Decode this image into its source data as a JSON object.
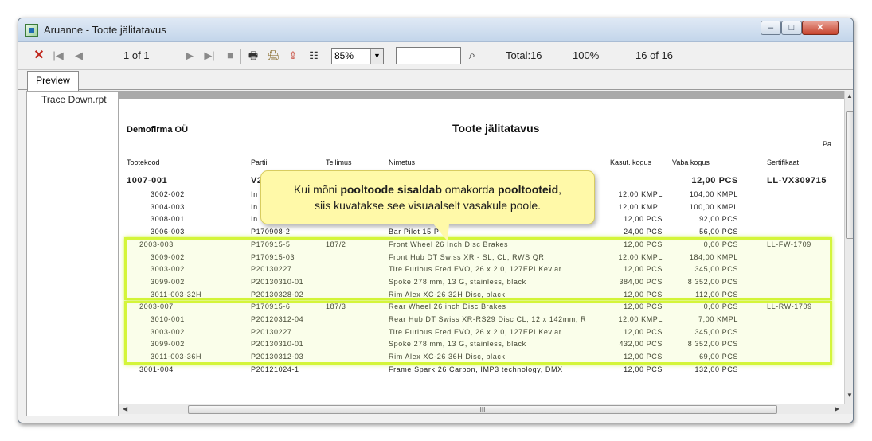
{
  "window": {
    "title": "Aruanne - Toote jälitatavus",
    "controls": {
      "minimize": "–",
      "maximize": "□",
      "close": "✕"
    }
  },
  "toolbar": {
    "page_indicator": "1 of 1",
    "zoom": "85%",
    "search_value": "",
    "total": "Total:16",
    "percent": "100%",
    "record_count": "16 of 16"
  },
  "tabs": {
    "preview": "Preview"
  },
  "tree": {
    "item": "Trace Down.rpt"
  },
  "report": {
    "company": "Demofirma OÜ",
    "title": "Toote jälitatavus",
    "page_label": "Pa",
    "columns": [
      "Tootekood",
      "Partii",
      "Tellimus",
      "Nimetus",
      "Kasut. kogus",
      "Vaba kogus",
      "Sertifikaat"
    ],
    "rows": [
      {
        "code": "1007-001",
        "lot": "V2",
        "order": "",
        "name": "",
        "used": "",
        "free": "12,00 PCS",
        "cert": "LL-VX309715"
      },
      {
        "code": "3002-002",
        "lot": "In",
        "order": "",
        "name": "",
        "used": "12,00 KMPL",
        "free": "104,00 KMPL",
        "cert": ""
      },
      {
        "code": "3004-003",
        "lot": "In",
        "order": "",
        "name": "",
        "used": "12,00 KMPL",
        "free": "100,00 KMPL",
        "cert": ""
      },
      {
        "code": "3008-001",
        "lot": "In",
        "order": "",
        "name": "",
        "used": "12,00 PCS",
        "free": "92,00 PCS",
        "cert": ""
      },
      {
        "code": "3006-003",
        "lot": "P170908-2",
        "order": "",
        "name": "Bar Pilot 15 Pro",
        "used": "24,00 PCS",
        "free": "56,00 PCS",
        "cert": ""
      },
      {
        "code": "2003-003",
        "lot": "P170915-5",
        "order": "187/2",
        "name": "Front Wheel 26 Inch Disc Brakes",
        "used": "12,00 PCS",
        "free": "0,00 PCS",
        "cert": "LL-FW-1709"
      },
      {
        "code": "3009-002",
        "lot": "P170915-03",
        "order": "",
        "name": "Front Hub DT Swiss XR - SL, CL, RWS QR",
        "used": "12,00 KMPL",
        "free": "184,00 KMPL",
        "cert": ""
      },
      {
        "code": "3003-002",
        "lot": "P20130227",
        "order": "",
        "name": "Tire Furious Fred EVO, 26 x 2.0, 127EPI Kevlar",
        "used": "12,00 PCS",
        "free": "345,00 PCS",
        "cert": ""
      },
      {
        "code": "3099-002",
        "lot": "P20130310-01",
        "order": "",
        "name": "Spoke 278 mm, 13 G, stainless, black",
        "used": "384,00 PCS",
        "free": "8 352,00 PCS",
        "cert": ""
      },
      {
        "code": "3011-003-32H",
        "lot": "P20130328-02",
        "order": "",
        "name": "Rim Alex XC-26 32H Disc, black",
        "used": "12,00 PCS",
        "free": "112,00 PCS",
        "cert": ""
      },
      {
        "code": "2003-007",
        "lot": "P170915-6",
        "order": "187/3",
        "name": "Rear Wheel 26 inch Disc Brakes",
        "used": "12,00 PCS",
        "free": "0,00 PCS",
        "cert": "LL-RW-1709"
      },
      {
        "code": "3010-001",
        "lot": "P20120312-04",
        "order": "",
        "name": "Rear Hub DT Swiss XR-RS29 Disc CL, 12 x 142mm, R",
        "used": "12,00 KMPL",
        "free": "7,00 KMPL",
        "cert": ""
      },
      {
        "code": "3003-002",
        "lot": "P20130227",
        "order": "",
        "name": "Tire Furious Fred EVO, 26 x 2.0, 127EPI Kevlar",
        "used": "12,00 PCS",
        "free": "345,00 PCS",
        "cert": ""
      },
      {
        "code": "3099-002",
        "lot": "P20130310-01",
        "order": "",
        "name": "Spoke 278 mm, 13 G, stainless, black",
        "used": "432,00 PCS",
        "free": "8 352,00 PCS",
        "cert": ""
      },
      {
        "code": "3011-003-36H",
        "lot": "P20130312-03",
        "order": "",
        "name": "Rim Alex XC-26 36H Disc, black",
        "used": "12,00 PCS",
        "free": "69,00 PCS",
        "cert": ""
      },
      {
        "code": "3001-004",
        "lot": "P20121024-1",
        "order": "",
        "name": "Frame Spark 26 Carbon, IMP3 technology, DMX",
        "used": "12,00 PCS",
        "free": "132,00 PCS",
        "cert": ""
      }
    ]
  },
  "callout": {
    "part1": "Kui mõni ",
    "bold1": "pooltoode sisaldab",
    "part2": " omakorda ",
    "bold2": "pooltooteid",
    "part3": ",",
    "line2": "siis kuvatakse see visuaalselt vasakule poole."
  },
  "scrollbar": {
    "h_grip": "III"
  },
  "colors": {
    "highlight": "#d4f53a",
    "callout_bg": "#fff9a8"
  }
}
